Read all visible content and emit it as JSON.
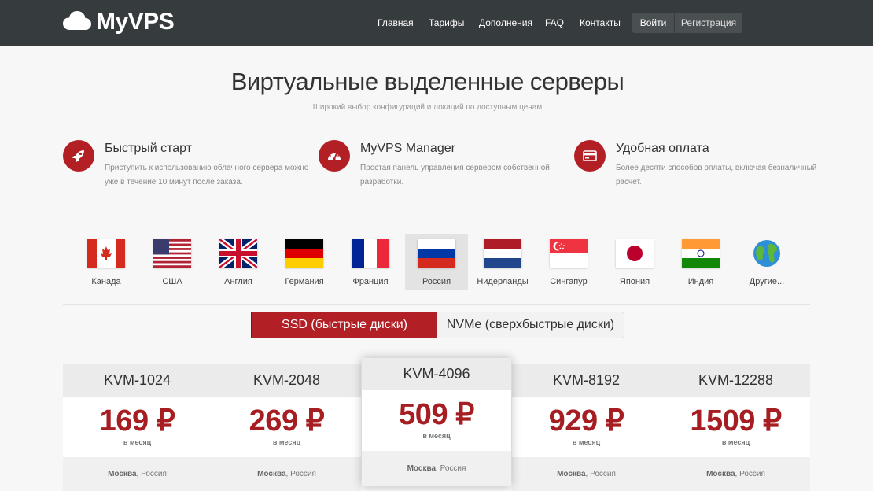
{
  "brand": {
    "name": "MyVPS",
    "logo_icon": "cloud-icon"
  },
  "nav": {
    "items": [
      "Главная",
      "Тарифы",
      "Дополнения",
      "FAQ",
      "Контакты"
    ],
    "login": "Войти",
    "register": "Регистрация"
  },
  "hero": {
    "title": "Виртуальные выделенные серверы",
    "subtitle": "Широкий выбор конфигураций и локаций по доступным ценам"
  },
  "features": [
    {
      "icon": "rocket-icon",
      "title": "Быстрый старт",
      "desc": "Приступить к использованию облачного сервера можно уже в течение 10 минут после заказа."
    },
    {
      "icon": "dashboard-icon",
      "title": "MyVPS Manager",
      "desc": "Простая панель управления сервером собственной разработки."
    },
    {
      "icon": "credit-card-icon",
      "title": "Удобная оплата",
      "desc": "Более десяти способов оплаты, включая безналичный расчет."
    }
  ],
  "countries": [
    {
      "name": "Канада",
      "active": false
    },
    {
      "name": "США",
      "active": false
    },
    {
      "name": "Англия",
      "active": false
    },
    {
      "name": "Германия",
      "active": false
    },
    {
      "name": "Франция",
      "active": false
    },
    {
      "name": "Россия",
      "active": true
    },
    {
      "name": "Нидерланды",
      "active": false
    },
    {
      "name": "Сингапур",
      "active": false
    },
    {
      "name": "Япония",
      "active": false
    },
    {
      "name": "Индия",
      "active": false
    },
    {
      "name": "Другие...",
      "active": false
    }
  ],
  "disk_toggle": {
    "ssd": "SSD (быстрые диски)",
    "nvme": "NVMe (сверхбыстрые диски)",
    "selected": "ssd"
  },
  "plans": [
    {
      "name": "KVM-1024",
      "price": "169 ₽",
      "period": "в месяц",
      "city": "Москва",
      "country": ", Россия",
      "featured": false
    },
    {
      "name": "KVM-2048",
      "price": "269 ₽",
      "period": "в месяц",
      "city": "Москва",
      "country": ", Россия",
      "featured": false
    },
    {
      "name": "KVM-4096",
      "price": "509 ₽",
      "period": "в месяц",
      "city": "Москва",
      "country": ", Россия",
      "featured": true
    },
    {
      "name": "KVM-8192",
      "price": "929 ₽",
      "period": "в месяц",
      "city": "Москва",
      "country": ", Россия",
      "featured": false
    },
    {
      "name": "KVM-12288",
      "price": "1509 ₽",
      "period": "в месяц",
      "city": "Москва",
      "country": ", Россия",
      "featured": false
    }
  ],
  "colors": {
    "accent": "#b21f24",
    "header": "#363b3d",
    "price": "#a61e22"
  }
}
